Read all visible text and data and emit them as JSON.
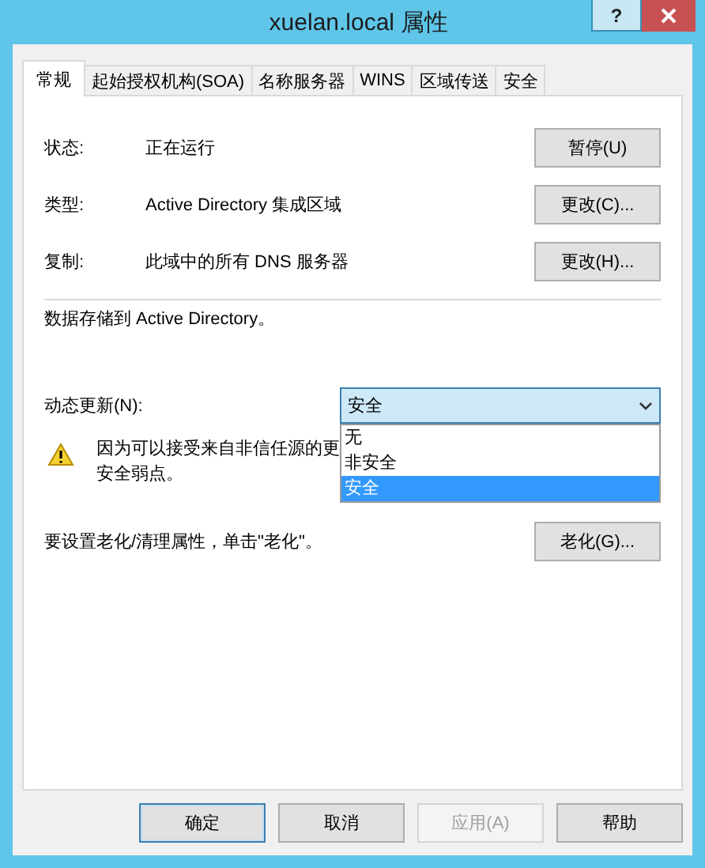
{
  "window": {
    "title": "xuelan.local 属性",
    "help_button": "?"
  },
  "tabs": [
    {
      "label": "常规",
      "selected": true
    },
    {
      "label": "起始授权机构(SOA)",
      "selected": false
    },
    {
      "label": "名称服务器",
      "selected": false
    },
    {
      "label": "WINS",
      "selected": false
    },
    {
      "label": "区域传送",
      "selected": false
    },
    {
      "label": "安全",
      "selected": false
    }
  ],
  "general": {
    "rows": [
      {
        "label": "状态:",
        "value": "正在运行",
        "button": "暂停(U)"
      },
      {
        "label": "类型:",
        "value": "Active Directory 集成区域",
        "button": "更改(C)..."
      },
      {
        "label": "复制:",
        "value": "此域中的所有 DNS 服务器",
        "button": "更改(H)..."
      }
    ],
    "storage_note": "数据存储到 Active Directory。",
    "dynamic_update": {
      "label": "动态更新(N):",
      "value": "安全",
      "expanded": true,
      "options": [
        {
          "label": "无",
          "selected": false
        },
        {
          "label": "非安全",
          "selected": false
        },
        {
          "label": "安全",
          "selected": true
        }
      ]
    },
    "warning": {
      "lines": [
        "因为可以接受来自非信任源的更",
        "安全弱点。"
      ]
    },
    "aging": {
      "text": "要设置老化/清理属性，单击\"老化\"。",
      "button": "老化(G)..."
    }
  },
  "buttons": [
    {
      "label": "确定",
      "kind": "default",
      "disabled": false
    },
    {
      "label": "取消",
      "kind": "normal",
      "disabled": false
    },
    {
      "label": "应用(A)",
      "kind": "normal",
      "disabled": true
    },
    {
      "label": "帮助",
      "kind": "normal",
      "disabled": false
    }
  ]
}
